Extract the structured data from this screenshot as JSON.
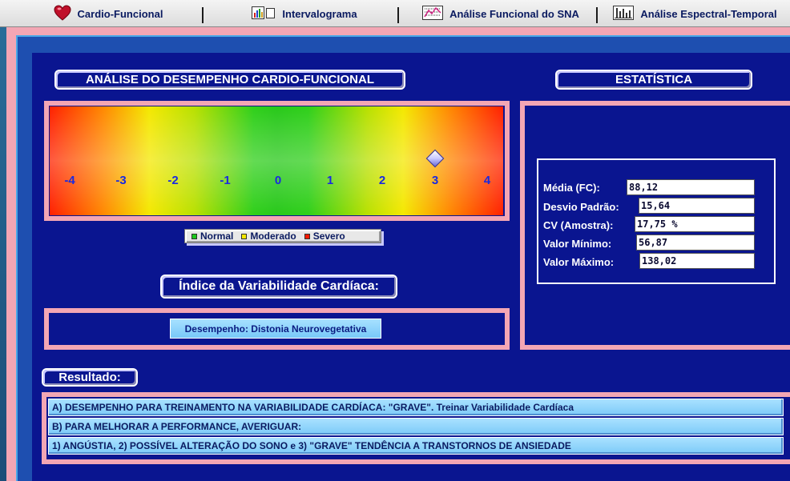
{
  "tabs": [
    {
      "label": "Cardio-Funcional",
      "icon": "heart-icon"
    },
    {
      "label": "Intervalograma",
      "icon": "bar-chart-icon"
    },
    {
      "label": "Análise Funcional do SNA",
      "icon": "spectrum-icon"
    },
    {
      "label": "Análise Espectral-Temporal",
      "icon": "spectral-bars-icon"
    }
  ],
  "performance_section": {
    "title": "ANÁLISE DO DESEMPENHO CARDIO-FUNCIONAL",
    "scale_ticks": [
      "-4",
      "-3",
      "-2",
      "-1",
      "0",
      "1",
      "2",
      "3",
      "4"
    ],
    "marker_value": 3,
    "legend": [
      {
        "label": "Normal",
        "color": "#1ec81e"
      },
      {
        "label": "Moderado",
        "color": "#f4e800"
      },
      {
        "label": "Severo",
        "color": "#ff1a00"
      }
    ]
  },
  "variability_index": {
    "title": "Índice da Variabilidade Cardíaca:",
    "performance_label": "Desempenho: Distonia Neurovegetativa"
  },
  "statistics": {
    "title": "ESTATÍSTICA",
    "rows": [
      {
        "label": "Média (FC):",
        "value": "88,12"
      },
      {
        "label": "Desvio Padrão:",
        "value": "15,64"
      },
      {
        "label": "CV (Amostra):",
        "value": "17,75 %"
      },
      {
        "label": "Valor Mínimo:",
        "value": "56,87"
      },
      {
        "label": "Valor Máximo:",
        "value": "138,02"
      }
    ]
  },
  "results": {
    "title": "Resultado:",
    "lines": [
      "A) DESEMPENHO PARA TREINAMENTO NA VARIABILIDADE CARDÍACA: \"GRAVE\". Treinar Variabilidade Cardíaca",
      "B) PARA MELHORAR A PERFORMANCE, AVERIGUAR:",
      "1) ANGÚSTIA, 2) POSSÍVEL ALTERAÇÃO DO SONO e 3) \"GRAVE\" TENDÊNCIA A TRANSTORNOS DE ANSIEDADE"
    ]
  },
  "colors": {
    "panel_bg": "#0a1590",
    "frame_pink": "#f3a6b4",
    "tick_blue": "#1a2ae0"
  }
}
